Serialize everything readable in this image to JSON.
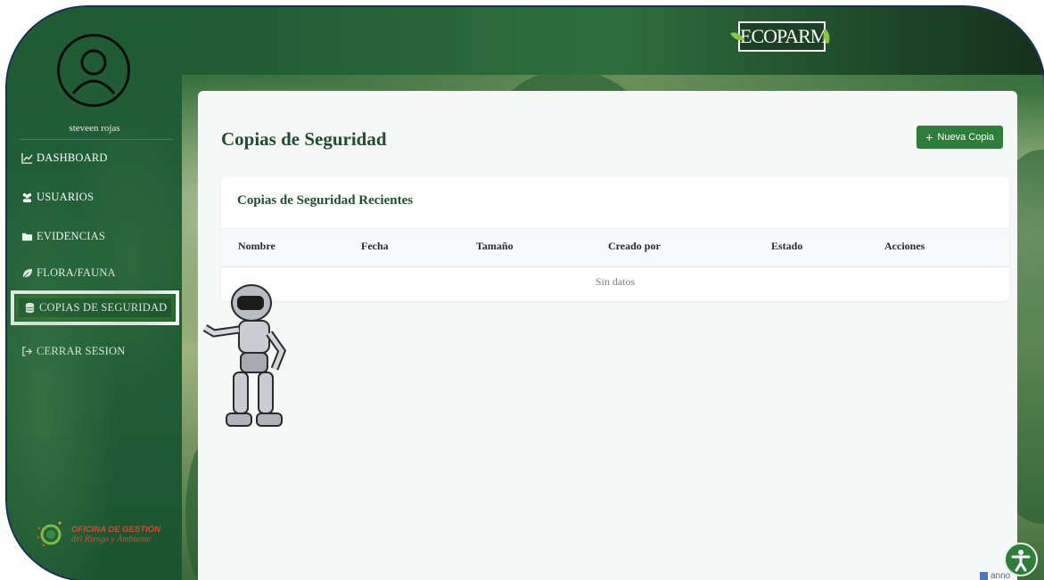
{
  "brand": {
    "name": "ECOPARM"
  },
  "sidebar": {
    "username": "steveen rojas",
    "items": [
      {
        "label": "DASHBOARD",
        "icon": "chart-line-icon"
      },
      {
        "label": "USUARIOS",
        "icon": "users-icon"
      },
      {
        "label": "EVIDENCIAS",
        "icon": "folder-icon"
      },
      {
        "label": "FLORA/FAUNA",
        "icon": "leaf-icon"
      },
      {
        "label": "COPIAS DE SEGURIDAD",
        "icon": "database-icon",
        "active": true
      },
      {
        "label": "CERRAR SESION",
        "icon": "sign-out-icon"
      }
    ],
    "office_logo": {
      "line1": "OFICINA DE GESTIÓN",
      "line2": "del Riesgo y Ambiente"
    }
  },
  "main": {
    "title": "Copias de Seguridad",
    "new_button": "Nueva Copia",
    "card_title": "Copias de Seguridad Recientes",
    "table": {
      "columns": [
        "Nombre",
        "Fecha",
        "Tamaño",
        "Creado por",
        "Estado",
        "Acciones"
      ],
      "rows": [],
      "empty_text": "Sin datos"
    }
  },
  "widgets": {
    "annot_text": "anno"
  },
  "colors": {
    "primary": "#2e7d3b",
    "title": "#214d2f",
    "sidebar": "#1e5b33"
  }
}
